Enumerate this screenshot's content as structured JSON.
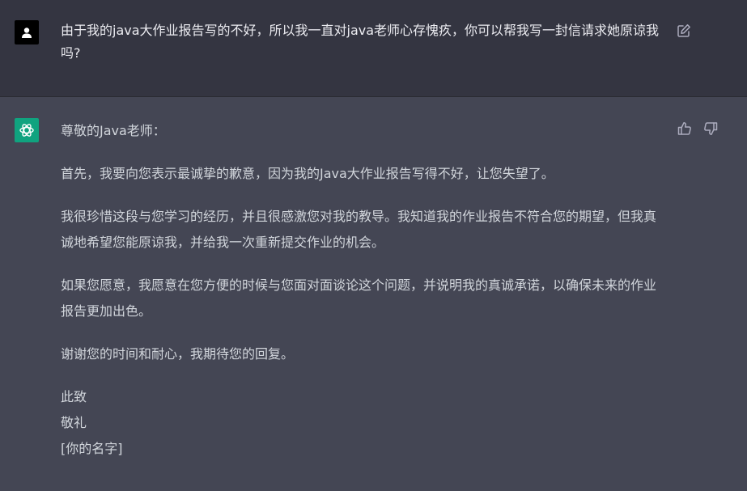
{
  "user_message": {
    "text": "由于我的java大作业报告写的不好，所以我一直对java老师心存愧疚，你可以帮我写一封信请求她原谅我吗?"
  },
  "assistant_message": {
    "greeting": "尊敬的Java老师：",
    "paragraphs": [
      "首先，我要向您表示最诚挚的歉意，因为我的Java大作业报告写得不好，让您失望了。",
      "我很珍惜这段与您学习的经历，并且很感激您对我的教导。我知道我的作业报告不符合您的期望，但我真诚地希望您能原谅我，并给我一次重新提交作业的机会。",
      "如果您愿意，我愿意在您方便的时候与您面对面谈论这个问题，并说明我的真诚承诺，以确保未来的作业报告更加出色。",
      "谢谢您的时间和耐心，我期待您的回复。"
    ],
    "closing": [
      "此致",
      "敬礼",
      "[你的名字]"
    ]
  },
  "icons": {
    "user_avatar": "user-silhouette-icon",
    "edit": "edit-icon",
    "assistant_avatar": "openai-logo-icon",
    "thumbs_up": "thumbs-up-icon",
    "thumbs_down": "thumbs-down-icon"
  },
  "colors": {
    "user_row_bg": "#343541",
    "assistant_row_bg": "#444654",
    "assistant_avatar_bg": "#10a37f",
    "text": "#d1d5db"
  }
}
